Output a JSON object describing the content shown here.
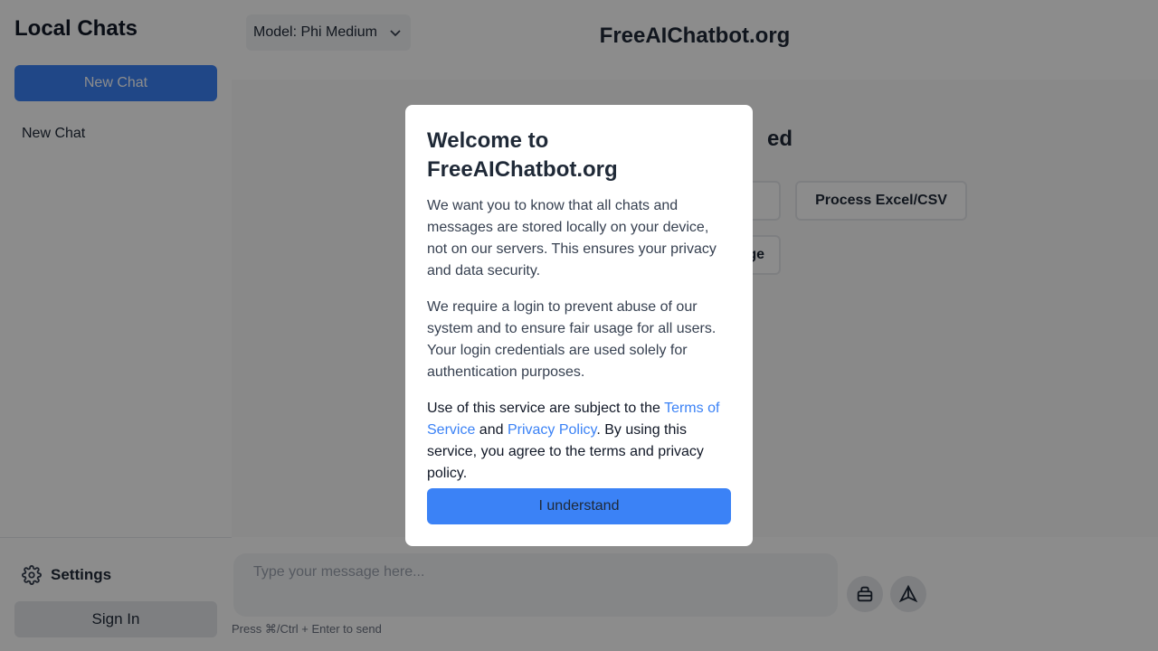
{
  "sidebar": {
    "title": "Local Chats",
    "new_chat_button": "New Chat",
    "chats": [
      "New Chat"
    ],
    "settings_label": "Settings",
    "sign_in_button": "Sign In"
  },
  "header": {
    "model_selector": "Model: Phi Medium",
    "site_title": "FreeAIChatbot.org"
  },
  "main": {
    "heading_fragment": "ed",
    "action_buttons": [
      "",
      "Process Excel/CSV",
      "ge"
    ]
  },
  "composer": {
    "placeholder": "Type your message here...",
    "hint": "Press ⌘/Ctrl + Enter to send",
    "attach_icon": "attach-icon",
    "send_icon": "send-icon"
  },
  "modal": {
    "title": "Welcome to FreeAIChatbot.org",
    "paragraph1": "We want you to know that all chats and messages are stored locally on your device, not on our servers. This ensures your privacy and data security.",
    "paragraph2": "We require a login to prevent abuse of our system and to ensure fair usage for all users. Your login credentials are used solely for authentication purposes.",
    "paragraph3_before": "Use of this service are subject to the ",
    "terms_link": "Terms of Service",
    "paragraph3_and": " and ",
    "privacy_link": "Privacy Policy",
    "paragraph3_after": ". By using this service, you agree to the terms and privacy policy.",
    "understand_button": "I understand"
  },
  "colors": {
    "accent": "#3b82f6",
    "overlay": "rgba(0,0,0,0.45)"
  }
}
